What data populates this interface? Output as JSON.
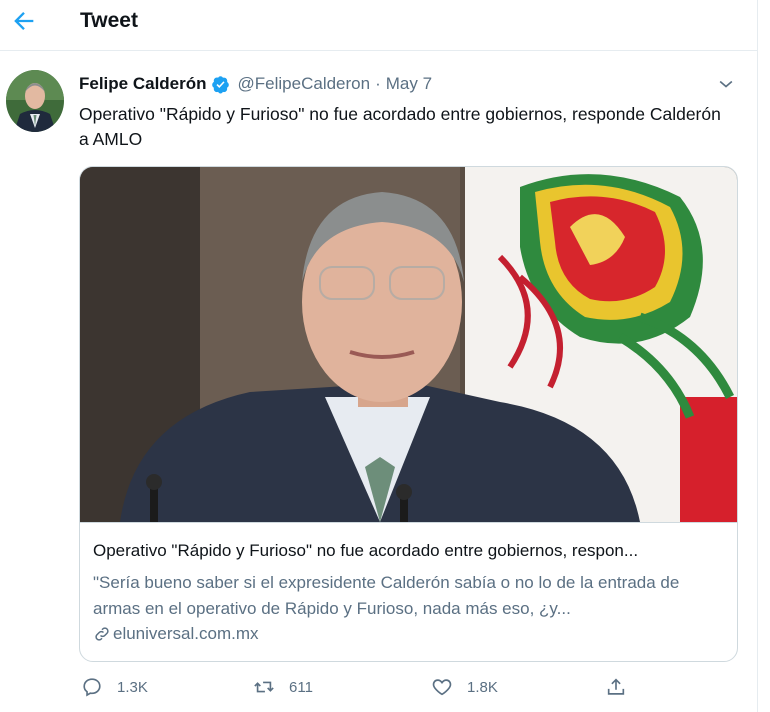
{
  "header": {
    "title": "Tweet",
    "back_icon": "arrow-left-icon"
  },
  "colors": {
    "accent": "#1da1f2",
    "muted": "#5b7083",
    "border": "#cfd9de",
    "text": "#0f1419"
  },
  "tweet": {
    "author_name": "Felipe Calderón",
    "handle": "@FelipeCalderon",
    "separator": "·",
    "date": "May 7",
    "text": "Operativo \"Rápido y Furioso\" no fue acordado entre gobiernos, responde Calderón a AMLO",
    "card": {
      "title": "Operativo \"Rápido y Furioso\" no fue acordado entre gobiernos, respon...",
      "description": "\"Sería bueno saber si el expresidente Calderón sabía o no lo de la entrada de armas en el operativo de Rápido y Furioso, nada más eso, ¿y...",
      "domain": "eluniversal.com.mx"
    },
    "actions": {
      "reply_count": "1.3K",
      "retweet_count": "611",
      "like_count": "1.8K"
    }
  }
}
